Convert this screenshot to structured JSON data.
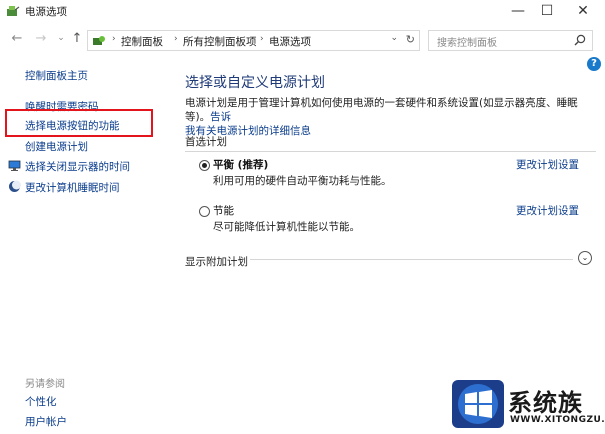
{
  "window": {
    "title": "电源选项",
    "minimize_glyph": "—",
    "maximize_glyph": "☐",
    "close_glyph": "✕"
  },
  "address": {
    "crumbs": [
      "控制面板",
      "所有控制面板项",
      "电源选项"
    ],
    "search_placeholder": "搜索控制面板"
  },
  "sidebar": {
    "items": [
      {
        "label": "控制面板主页"
      },
      {
        "label": "唤醒时需要密码"
      },
      {
        "label": "选择电源按钮的功能"
      },
      {
        "label": "创建电源计划"
      },
      {
        "label": "选择关闭显示器的时间"
      },
      {
        "label": "更改计算机睡眠时间"
      }
    ],
    "see_also_label": "另请参阅",
    "see_also_items": [
      {
        "label": "个性化"
      },
      {
        "label": "用户帐户"
      }
    ]
  },
  "main": {
    "title": "选择或自定义电源计划",
    "description_text": "电源计划是用于管理计算机如何使用电源的一套硬件和系统设置(如显示器亮度、睡眠等)。",
    "description_link_1": "告诉",
    "description_link_2": "我有关电源计划的详细信息",
    "preferred_label": "首选计划",
    "plans": [
      {
        "name": "平衡 (推荐)",
        "desc": "利用可用的硬件自动平衡功耗与性能。",
        "link": "更改计划设置",
        "selected": true
      },
      {
        "name": "节能",
        "desc": "尽可能降低计算机性能以节能。",
        "link": "更改计划设置",
        "selected": false
      }
    ],
    "extra_label": "显示附加计划"
  },
  "help_glyph": "?",
  "watermark": {
    "text": "系统族",
    "url": "WWW.XITONGZU.COM"
  },
  "colors": {
    "link": "#0a3c8c",
    "title": "#1e3a78",
    "highlight": "#e3141c",
    "help": "#1979ca"
  }
}
